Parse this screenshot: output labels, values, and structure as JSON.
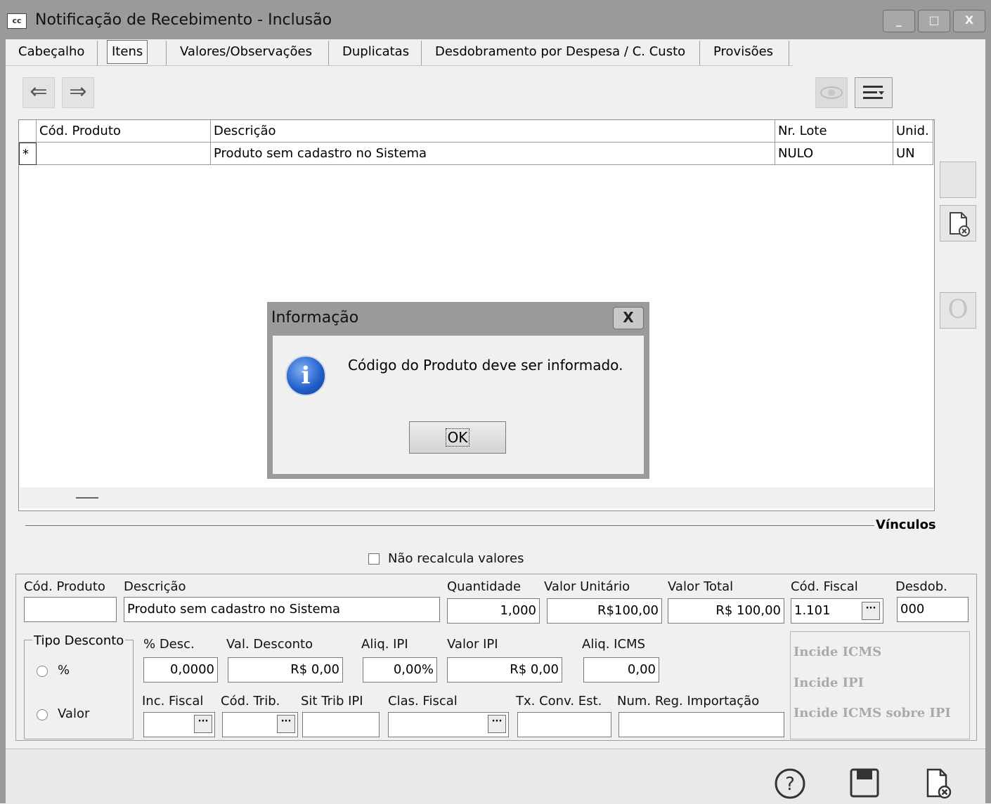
{
  "window": {
    "title": "Notificação de Recebimento - Inclusão",
    "icon_label": "cc",
    "controls": [
      "_",
      "□",
      "X"
    ]
  },
  "tabs": [
    {
      "label": "Cabeçalho"
    },
    {
      "label": "Itens",
      "active": true
    },
    {
      "label": "Valores/Observações"
    },
    {
      "label": "Duplicatas"
    },
    {
      "label": "Desdobramento por Despesa / C. Custo"
    },
    {
      "label": "Provisões"
    }
  ],
  "toolbar": {
    "prev_icon": "⇐",
    "next_icon": "⇒",
    "view_icon": "eye-icon",
    "list_icon": "list-icon"
  },
  "grid": {
    "columns": [
      "Cód. Produto",
      "Descrição",
      "Nr. Lote",
      "Unid."
    ],
    "rows": [
      {
        "indicator": "*",
        "codigo": "",
        "descricao": "Produto sem cadastro no Sistema",
        "lote": "NULO",
        "unid": "UN"
      }
    ]
  },
  "side_buttons": {
    "btn3_label": "O"
  },
  "dialog": {
    "title": "Informação",
    "close_label": "X",
    "icon_glyph": "i",
    "message": "Código do Produto deve ser informado.",
    "ok_label": "OK"
  },
  "vinculos": {
    "label": "Vínculos"
  },
  "options": {
    "nao_recalcula_label": "Não recalcula valores",
    "nao_recalcula_checked": false
  },
  "detail": {
    "cod_produto": {
      "label": "Cód. Produto",
      "value": ""
    },
    "descricao": {
      "label": "Descrição",
      "value": "Produto sem cadastro no Sistema"
    },
    "quantidade": {
      "label": "Quantidade",
      "value": "1,000"
    },
    "valor_unitario": {
      "label": "Valor Unitário",
      "value": "R$100,00"
    },
    "valor_total": {
      "label": "Valor Total",
      "value": "R$ 100,00"
    },
    "cod_fiscal": {
      "label": "Cód. Fiscal",
      "value": "1.101"
    },
    "desdob": {
      "label": "Desdob.",
      "value": "000"
    },
    "tipo_desconto": {
      "label": "Tipo Desconto",
      "options": [
        "%",
        "Valor"
      ]
    },
    "perc_desc": {
      "label": "% Desc.",
      "value": "0,0000"
    },
    "val_desconto": {
      "label": "Val. Desconto",
      "value": "R$ 0,00"
    },
    "aliq_ipi": {
      "label": "Aliq. IPI",
      "value": "0,00%"
    },
    "valor_ipi": {
      "label": "Valor IPI",
      "value": "R$ 0,00"
    },
    "aliq_icms": {
      "label": "Aliq. ICMS",
      "value": "0,00"
    },
    "inc_fiscal": {
      "label": "Inc. Fiscal",
      "value": ""
    },
    "cod_trib": {
      "label": "Cód. Trib.",
      "value": ""
    },
    "sit_trib_ipi": {
      "label": "Sit Trib IPI",
      "value": ""
    },
    "clas_fiscal": {
      "label": "Clas. Fiscal",
      "value": ""
    },
    "tx_conv_est": {
      "label": "Tx. Conv. Est.",
      "value": ""
    },
    "num_reg_importacao": {
      "label": "Num. Reg. Importação",
      "value": ""
    },
    "dots_label": "···",
    "incide": [
      "Incide ICMS",
      "Incide IPI",
      "Incide ICMS sobre IPI"
    ]
  },
  "footer": {
    "help_icon": "help-icon",
    "save_icon": "save-icon",
    "cancel_icon": "cancel-doc-icon"
  }
}
